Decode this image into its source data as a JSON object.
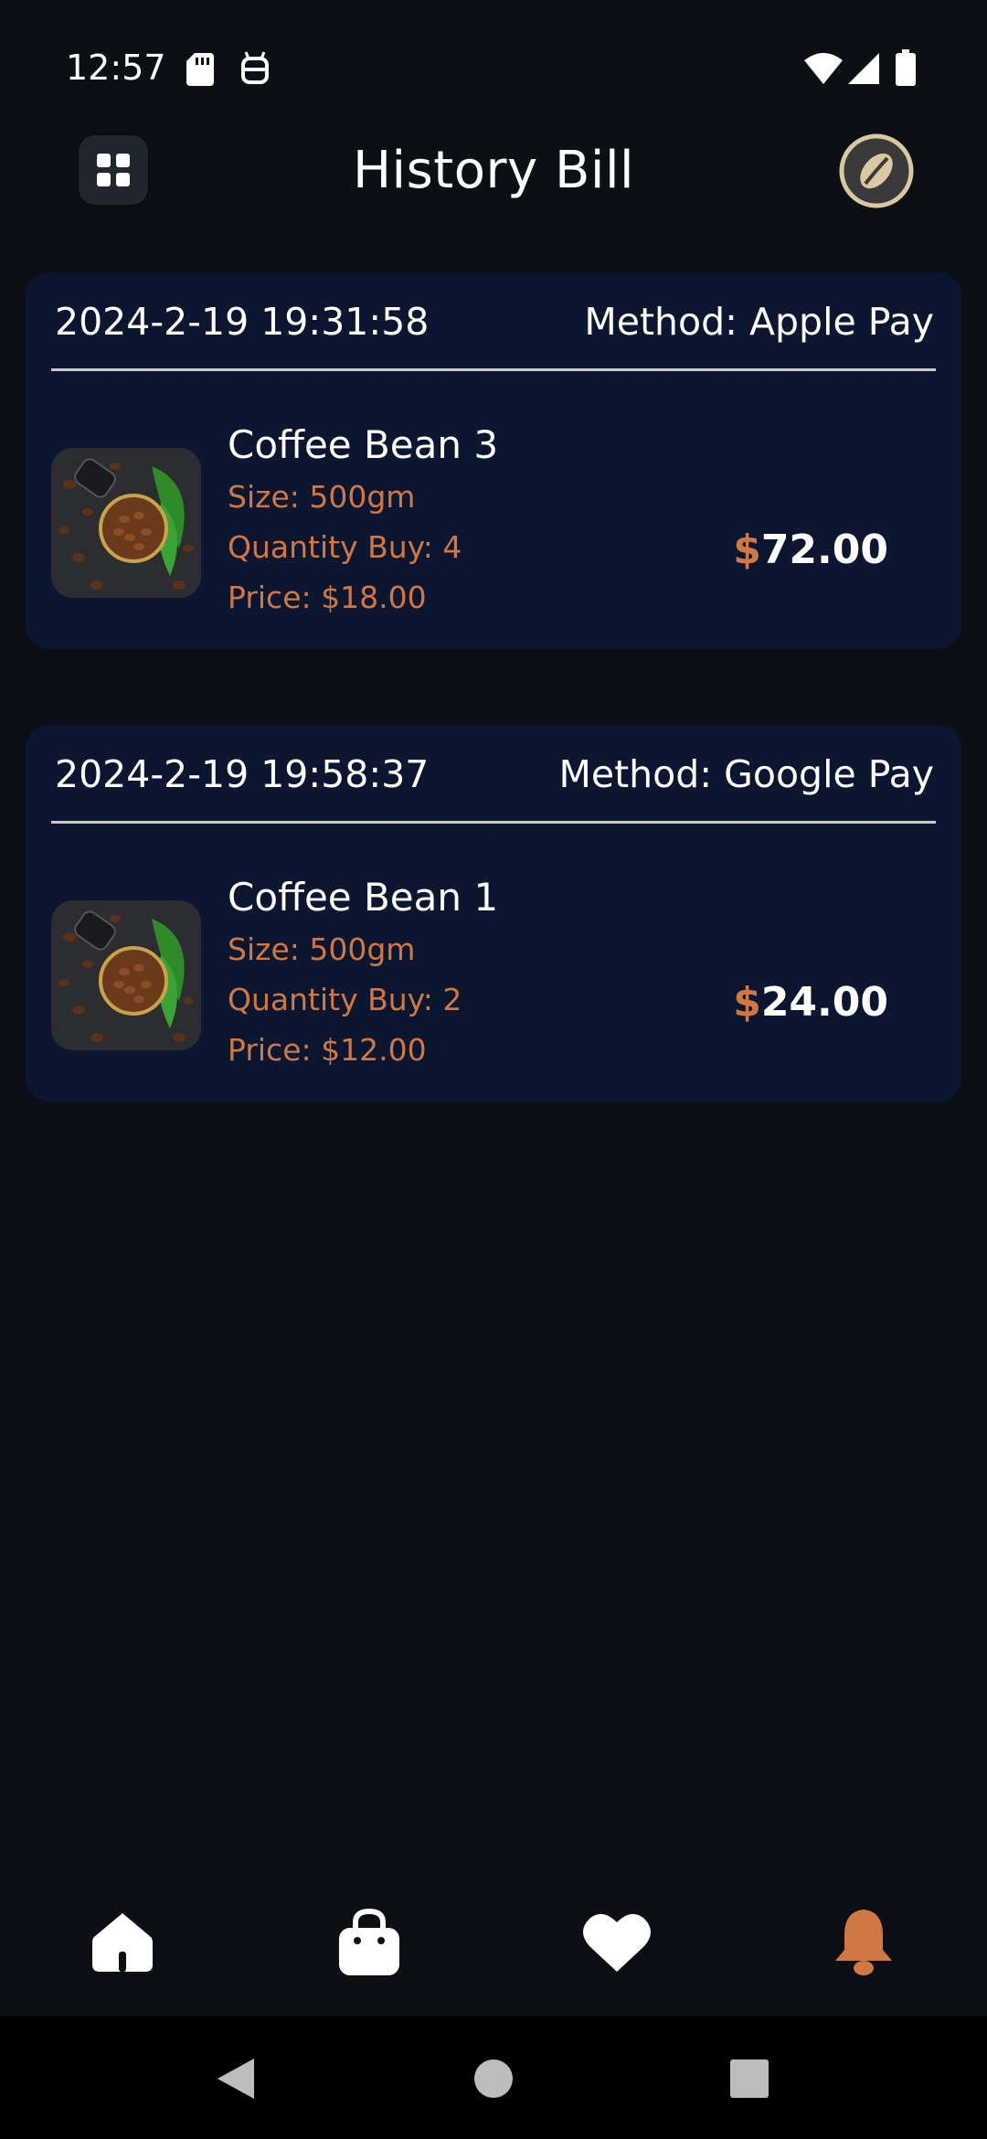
{
  "status_bar": {
    "time": "12:57",
    "icons": [
      "sd-card-icon",
      "robot-icon",
      "wifi-icon",
      "signal-icon",
      "battery-icon"
    ]
  },
  "header": {
    "title": "History Bill",
    "menu_icon": "grid-icon",
    "avatar_icon": "coffee-bean-icon"
  },
  "bills": [
    {
      "date": "2024-2-19 19:31:58",
      "method": "Method: Apple Pay",
      "item": {
        "name": "Coffee Bean 3",
        "size": "Size: 500gm",
        "quantity": "Quantity Buy: 4",
        "price": "Price: $18.00",
        "total_currency": "$",
        "total_amount": "72.00"
      }
    },
    {
      "date": "2024-2-19 19:58:37",
      "method": "Method: Google Pay",
      "item": {
        "name": "Coffee Bean 1",
        "size": "Size: 500gm",
        "quantity": "Quantity Buy: 2",
        "price": "Price: $12.00",
        "total_currency": "$",
        "total_amount": "24.00"
      }
    }
  ],
  "tabs": [
    {
      "name": "home",
      "icon": "home-icon",
      "active": false
    },
    {
      "name": "cart",
      "icon": "bag-icon",
      "active": false
    },
    {
      "name": "favorites",
      "icon": "heart-icon",
      "active": false
    },
    {
      "name": "history",
      "icon": "bell-icon",
      "active": true
    }
  ],
  "colors": {
    "background": "#0c0f14",
    "card": "#0b1631",
    "accent": "#d17842",
    "text": "#ffffff"
  },
  "system_nav": [
    "back-icon",
    "home-circle-icon",
    "recents-icon"
  ]
}
